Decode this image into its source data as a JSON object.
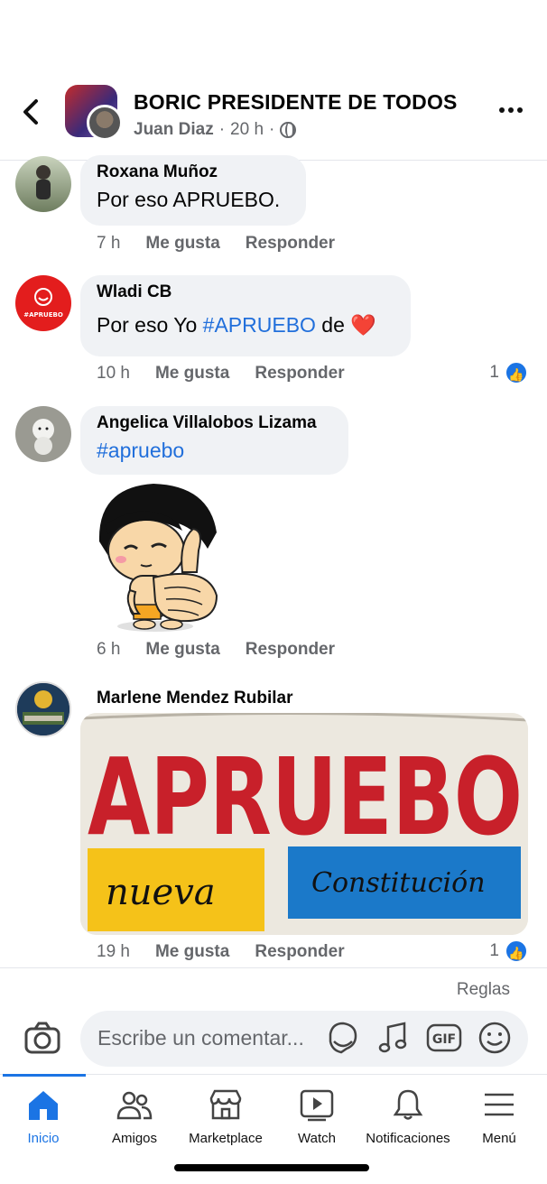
{
  "header": {
    "group_name": "BORIC PRESIDENTE DE TODOS",
    "author": "Juan Diaz",
    "separator": "·",
    "time": "20 h",
    "separator2": "·"
  },
  "comments": [
    {
      "name": "Roxana Muñoz",
      "text": "Por eso APRUEBO.",
      "time": "7 h",
      "like_label": "Me gusta",
      "reply_label": "Responder"
    },
    {
      "name": "Wladi CB",
      "text_prefix": "Por eso Yo ",
      "hashtag": "#APRUEBO",
      "text_suffix": " de",
      "emoji": "❤️",
      "avatar_text": "#APRUEBO",
      "time": "10 h",
      "like_label": "Me gusta",
      "reply_label": "Responder",
      "reactions": "1"
    },
    {
      "name": "Angelica Villalobos Lizama",
      "hashtag": "#apruebo",
      "time": "6 h",
      "like_label": "Me gusta",
      "reply_label": "Responder"
    },
    {
      "name": "Marlene Mendez Rubilar",
      "image_text_main": "APRUEBO",
      "image_text_left": "nueva",
      "image_text_right": "Constitución",
      "time": "19 h",
      "like_label": "Me gusta",
      "reply_label": "Responder",
      "reactions": "1"
    }
  ],
  "composer": {
    "rules_label": "Reglas",
    "placeholder": "Escribe un comentar...",
    "gif_label": "GIF"
  },
  "tabs": [
    {
      "label": "Inicio",
      "icon": "home-icon",
      "active": true
    },
    {
      "label": "Amigos",
      "icon": "friends-icon"
    },
    {
      "label": "Marketplace",
      "icon": "marketplace-icon"
    },
    {
      "label": "Watch",
      "icon": "watch-icon"
    },
    {
      "label": "Notificaciones",
      "icon": "bell-icon"
    },
    {
      "label": "Menú",
      "icon": "menu-icon"
    }
  ],
  "colors": {
    "accent": "#1b74e4",
    "hashtag": "#216fdb",
    "bubble": "#f0f2f5",
    "muted": "#65676b"
  }
}
